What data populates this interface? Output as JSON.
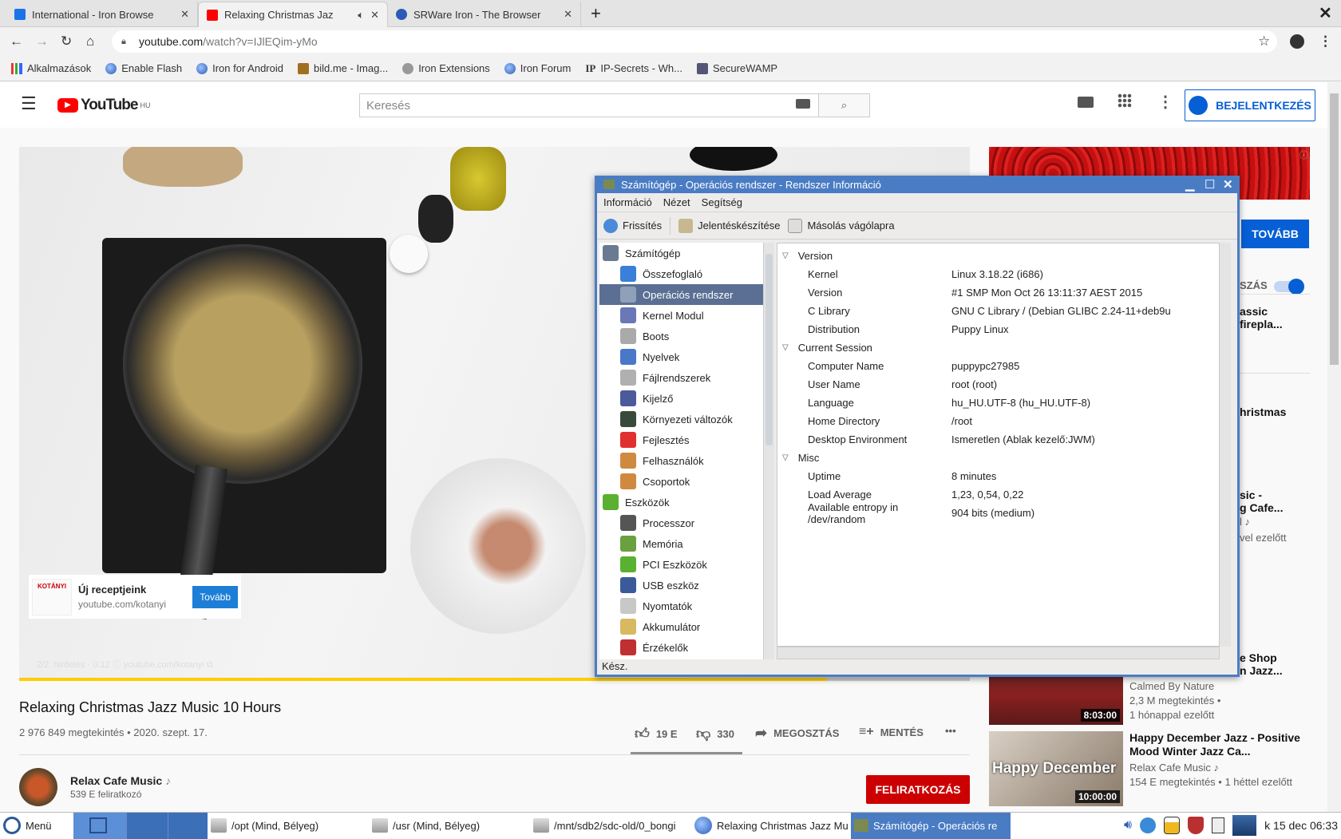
{
  "browser": {
    "tabs": [
      {
        "title": "International - Iron Browse",
        "active": false,
        "favicon": "document-icon",
        "color": "#1a73e8"
      },
      {
        "title": "Relaxing Christmas Jaz",
        "active": true,
        "favicon": "youtube-icon",
        "color": "#ff0000",
        "audio": true
      },
      {
        "title": "SRWare Iron - The Browser",
        "active": false,
        "favicon": "globe-icon",
        "color": "#2a5bb5"
      }
    ],
    "new_tab": "+",
    "close_window": "✕",
    "url_host": "youtube.com",
    "url_path": "/watch?v=IJlEQim-yMo",
    "bookmarks": [
      "Alkalmazások",
      "Enable Flash",
      "Iron for Android",
      "bild.me - Imag...",
      "Iron Extensions",
      "Iron Forum",
      "IP-Secrets - Wh...",
      "SecureWAMP"
    ]
  },
  "youtube": {
    "logo": "YouTube",
    "region": "HU",
    "search_placeholder": "Keresés",
    "sign_in": "BEJELENTKEZÉS",
    "video": {
      "ad_title": "Új receptjeink",
      "ad_url": "youtube.com/kotanyi",
      "ad_button": "Tovább",
      "ad_overlay": "2/2. hirdetés · 0:12 ⓘ  youtube.com/kotanyi ⧉",
      "progress": 0.85
    },
    "title": "Relaxing Christmas Jazz Music 10 Hours",
    "meta": "2 976 849 megtekintés • 2020. szept. 17.",
    "likes": "19 E",
    "dislikes": "330",
    "share": "MEGOSZTÁS",
    "save": "MENTÉS",
    "more": "•••",
    "channel": {
      "name": "Relax Cafe Music",
      "subs": "539 E feliratkozó",
      "badge": "♪"
    },
    "subscribe": "FELIRATKOZÁS",
    "sidebar": {
      "ad_button": "TOVÁBB",
      "autoplay_label": "SZÁS",
      "autoplay_on": true,
      "partial": [
        {
          "line1": "assic",
          "line2": "firepla..."
        },
        {
          "line1": "hristmas"
        },
        {
          "line1": "sic -",
          "line2": "g Cafe...",
          "line3": "l ♪",
          "line4": "vel ezelőtt"
        },
        {
          "line1": "e Shop",
          "line2": "n Jazz..."
        }
      ],
      "items": [
        {
          "channel": "Calmed By Nature",
          "views": "2,3 M megtekintés •",
          "age": "1 hónappal ezelőtt",
          "duration": "8:03:00"
        },
        {
          "title": "Happy December Jazz - Positive Mood Winter Jazz Ca...",
          "channel": "Relax Cafe Music ♪",
          "meta": "154 E megtekintés • 1 héttel ezelőtt",
          "duration": "10:00:00",
          "thumb_text": "Happy December"
        }
      ]
    }
  },
  "dialog": {
    "title": "Számítógép - Operációs rendszer - Rendszer Információ",
    "menu": [
      "Információ",
      "Nézet",
      "Segítség"
    ],
    "toolbar": [
      "Frissítés",
      "Jelentéskészítése",
      "Másolás vágólapra"
    ],
    "tree": [
      {
        "label": "Számítógép",
        "level": 0,
        "icon": "computer-icon",
        "color": "#6a7a90"
      },
      {
        "label": "Összefoglaló",
        "level": 1,
        "icon": "info-icon",
        "color": "#3a7fd8"
      },
      {
        "label": "Operációs rendszer",
        "level": 1,
        "icon": "gear-icon",
        "color": "#8fa0b8",
        "selected": true
      },
      {
        "label": "Kernel Modul",
        "level": 1,
        "icon": "diamond-icon",
        "color": "#6a78b8"
      },
      {
        "label": "Boots",
        "level": 1,
        "icon": "power-icon",
        "color": "#aaaaaa"
      },
      {
        "label": "Nyelvek",
        "level": 1,
        "icon": "flag-icon",
        "color": "#4a78c8"
      },
      {
        "label": "Fájlrendszerek",
        "level": 1,
        "icon": "drive-icon",
        "color": "#b0b0b0"
      },
      {
        "label": "Kijelző",
        "level": 1,
        "icon": "monitor-icon",
        "color": "#4a5a9a"
      },
      {
        "label": "Környezeti változók",
        "level": 1,
        "icon": "terminal-icon",
        "color": "#3a4a3a"
      },
      {
        "label": "Fejlesztés",
        "level": 1,
        "icon": "tools-icon",
        "color": "#e03030"
      },
      {
        "label": "Felhasználók",
        "level": 1,
        "icon": "users-icon",
        "color": "#d08a40"
      },
      {
        "label": "Csoportok",
        "level": 1,
        "icon": "group-icon",
        "color": "#d08a40"
      },
      {
        "label": "Eszközök",
        "level": 0,
        "icon": "board-icon",
        "color": "#5ab030"
      },
      {
        "label": "Processzor",
        "level": 1,
        "icon": "cpu-icon",
        "color": "#555555"
      },
      {
        "label": "Memória",
        "level": 1,
        "icon": "memory-icon",
        "color": "#6aa040"
      },
      {
        "label": "PCI Eszközök",
        "level": 1,
        "icon": "pci-icon",
        "color": "#5ab030"
      },
      {
        "label": "USB eszköz",
        "level": 1,
        "icon": "usb-icon",
        "color": "#3a5a9a"
      },
      {
        "label": "Nyomtatók",
        "level": 1,
        "icon": "printer-icon",
        "color": "#c8c8c8"
      },
      {
        "label": "Akkumulátor",
        "level": 1,
        "icon": "battery-icon",
        "color": "#d8b860"
      },
      {
        "label": "Érzékelők",
        "level": 1,
        "icon": "thermometer-icon",
        "color": "#c03030"
      }
    ],
    "sections": [
      {
        "name": "Version",
        "rows": [
          [
            "Kernel",
            "Linux 3.18.22 (i686)"
          ],
          [
            "Version",
            "#1 SMP Mon Oct 26 13:11:37 AEST 2015"
          ],
          [
            "C Library",
            "GNU C Library / (Debian GLIBC 2.24-11+deb9u"
          ],
          [
            "Distribution",
            "Puppy Linux"
          ]
        ]
      },
      {
        "name": "Current Session",
        "rows": [
          [
            "Computer Name",
            "puppypc27985"
          ],
          [
            "User Name",
            "root (root)"
          ],
          [
            "Language",
            "hu_HU.UTF-8 (hu_HU.UTF-8)"
          ],
          [
            "Home Directory",
            "/root"
          ],
          [
            "Desktop Environment",
            "Ismeretlen (Ablak kezelő:JWM)"
          ]
        ]
      },
      {
        "name": "Misc",
        "rows": [
          [
            "Uptime",
            "8 minutes"
          ],
          [
            "Load Average",
            "1,23, 0,54, 0,22"
          ],
          [
            "Available entropy in /dev/random",
            "904 bits (medium)"
          ]
        ]
      }
    ],
    "status": "Kész."
  },
  "taskbar": {
    "menu": "Menü",
    "tasks": [
      "/opt (Mind, Bélyeg)",
      "/usr (Mind, Bélyeg)",
      "/mnt/sdb2/sdc-old/0_bongi",
      "Relaxing Christmas Jazz Mu",
      "Számítógép - Operációs re"
    ],
    "clock": "k 15 dec 06:33"
  }
}
